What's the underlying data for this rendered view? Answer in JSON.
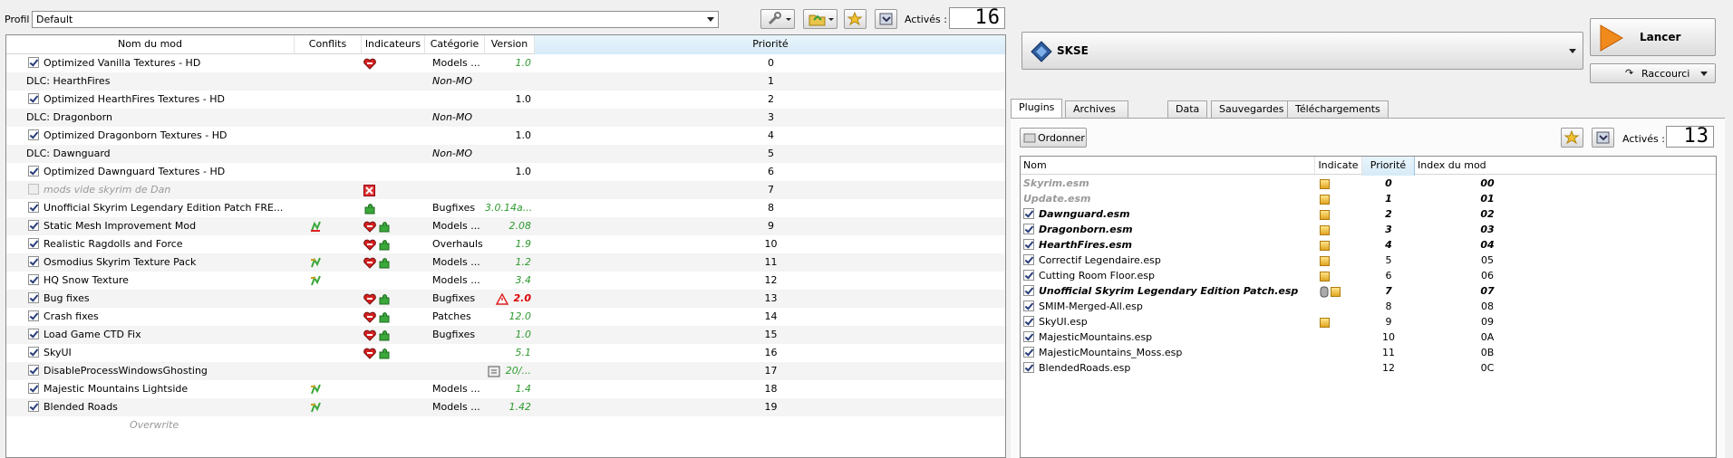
{
  "profile": {
    "label": "Profil",
    "value": "Default"
  },
  "toolbar": {
    "active_label": "Activés :",
    "active_count": "16"
  },
  "mod_table": {
    "columns": [
      "Nom du mod",
      "Conflits",
      "Indicateurs",
      "Catégorie",
      "Version",
      "Priorité"
    ],
    "rows": [
      {
        "name": "Optimized Vanilla Textures - HD",
        "checked": true,
        "ind": "heart",
        "cat": "Models ...",
        "ver": "1.0",
        "pri": "0"
      },
      {
        "name": "DLC: HearthFires",
        "checked": null,
        "cat": "Non-MO",
        "ver": "",
        "pri": "1"
      },
      {
        "name": "Optimized HearthFires Textures - HD",
        "checked": true,
        "cat": "",
        "ver": "1.0",
        "pri": "2"
      },
      {
        "name": "DLC: Dragonborn",
        "checked": null,
        "cat": "Non-MO",
        "ver": "",
        "pri": "3"
      },
      {
        "name": "Optimized Dragonborn Textures - HD",
        "checked": true,
        "cat": "",
        "ver": "1.0",
        "pri": "4"
      },
      {
        "name": "DLC: Dawnguard",
        "checked": null,
        "cat": "Non-MO",
        "ver": "",
        "pri": "5"
      },
      {
        "name": "Optimized Dawnguard Textures - HD",
        "checked": true,
        "cat": "",
        "ver": "1.0",
        "pri": "6"
      },
      {
        "name": "mods vide skyrim de Dan",
        "checked": false,
        "ind": "x",
        "cat": "",
        "ver": "",
        "pri": "7"
      },
      {
        "name": "Unofficial Skyrim Legendary Edition Patch FRE...",
        "checked": true,
        "ind": "puzzle",
        "cat": "Bugfixes",
        "ver": "3.0.14a...",
        "pri": "8"
      },
      {
        "name": "Static Mesh Improvement Mod",
        "checked": true,
        "conf": "flash-red",
        "ind": "both",
        "cat": "Models ...",
        "ver": "2.08",
        "pri": "9"
      },
      {
        "name": "Realistic Ragdolls and Force",
        "checked": true,
        "ind": "both",
        "cat": "Overhauls",
        "ver": "1.9",
        "pri": "10"
      },
      {
        "name": "Osmodius Skyrim Texture Pack",
        "checked": true,
        "conf": "flash",
        "ind": "both",
        "cat": "Models ...",
        "ver": "1.2",
        "pri": "11"
      },
      {
        "name": "HQ Snow Texture",
        "checked": true,
        "conf": "flash",
        "cat": "Models ...",
        "ver": "3.4",
        "pri": "12"
      },
      {
        "name": "Bug fixes",
        "checked": true,
        "ind": "both",
        "cat": "Bugfixes",
        "warn": true,
        "ver": "2.0",
        "verred": true,
        "pri": "13"
      },
      {
        "name": "Crash fixes",
        "checked": true,
        "ind": "both",
        "cat": "Patches",
        "ver": "12.0",
        "pri": "14"
      },
      {
        "name": "Load Game CTD Fix",
        "checked": true,
        "ind": "both",
        "cat": "Bugfixes",
        "ver": "1.0",
        "pri": "15"
      },
      {
        "name": "SkyUI",
        "checked": true,
        "ind": "both",
        "cat": "",
        "ver": "5.1",
        "pri": "16"
      },
      {
        "name": "DisableProcessWindowsGhosting",
        "checked": true,
        "cat": "",
        "note": true,
        "ver": "20/...",
        "pri": "17"
      },
      {
        "name": "Majestic Mountains Lightside",
        "checked": true,
        "conf": "flash",
        "cat": "Models ...",
        "ver": "1.4",
        "pri": "18"
      },
      {
        "name": "Blended Roads",
        "checked": true,
        "conf": "flash",
        "cat": "Models ...",
        "ver": "1.42",
        "pri": "19"
      }
    ],
    "overwrite": "Overwrite"
  },
  "executable": {
    "value": "SKSE",
    "run_label": "Lancer",
    "shortcut_label": "Raccourci"
  },
  "tabs": [
    "Plugins",
    "Archives Bethesda",
    "Data",
    "Sauvegardes",
    "Téléchargements"
  ],
  "plugins": {
    "sort_label": "Ordonner",
    "active_label": "Activés :",
    "active_count": "13",
    "columns": [
      "Nom",
      "Indicate",
      "Priorité",
      "Index du mod"
    ],
    "rows": [
      {
        "name": "Skyrim.esm",
        "checked": null,
        "master": true,
        "box": true,
        "pri": "0",
        "idx": "00"
      },
      {
        "name": "Update.esm",
        "checked": null,
        "master": true,
        "box": true,
        "pri": "1",
        "idx": "01"
      },
      {
        "name": "Dawnguard.esm",
        "checked": true,
        "master": true,
        "box": true,
        "pri": "2",
        "idx": "02"
      },
      {
        "name": "Dragonborn.esm",
        "checked": true,
        "master": true,
        "box": true,
        "pri": "3",
        "idx": "03"
      },
      {
        "name": "HearthFires.esm",
        "checked": true,
        "master": true,
        "box": true,
        "pri": "4",
        "idx": "04"
      },
      {
        "name": "Correctif Legendaire.esp",
        "checked": true,
        "box": true,
        "pri": "5",
        "idx": "05"
      },
      {
        "name": "Cutting Room Floor.esp",
        "checked": true,
        "box": true,
        "pri": "6",
        "idx": "06"
      },
      {
        "name": "Unofficial Skyrim Legendary Edition Patch.esp",
        "checked": true,
        "master": true,
        "clip": true,
        "box": true,
        "pri": "7",
        "idx": "07"
      },
      {
        "name": "SMIM-Merged-All.esp",
        "checked": true,
        "pri": "8",
        "idx": "08"
      },
      {
        "name": "SkyUI.esp",
        "checked": true,
        "box": true,
        "pri": "9",
        "idx": "09"
      },
      {
        "name": "MajesticMountains.esp",
        "checked": true,
        "pri": "10",
        "idx": "0A"
      },
      {
        "name": "MajesticMountains_Moss.esp",
        "checked": true,
        "pri": "11",
        "idx": "0B"
      },
      {
        "name": "BlendedRoads.esp",
        "checked": true,
        "pri": "12",
        "idx": "0C"
      }
    ]
  }
}
